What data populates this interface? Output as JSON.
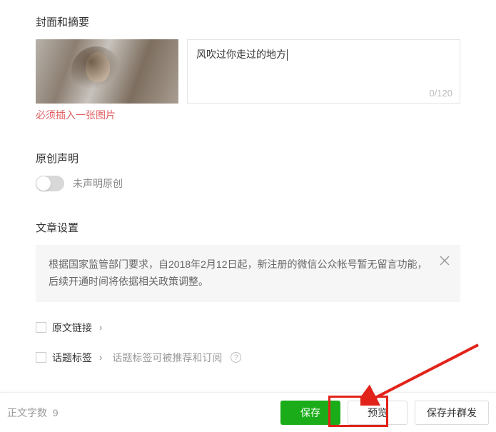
{
  "sections": {
    "cover_title": "封面和摘要",
    "original_title": "原创声明",
    "settings_title": "文章设置"
  },
  "cover": {
    "summary_value": "风吹过你走过的地方",
    "char_count": "0/120",
    "error": "必须插入一张图片"
  },
  "original": {
    "toggle_label": "未声明原创"
  },
  "notice": {
    "text": "根据国家监管部门要求，自2018年2月12日起，新注册的微信公众帐号暂无留言功能，后续开通时间将依据相关政策调整。"
  },
  "settings": {
    "source_link": "原文链接",
    "topic_tag": "话题标签",
    "topic_hint": "话题标签可被推荐和订阅"
  },
  "footer": {
    "word_count_label": "正文字数",
    "word_count_value": "9",
    "save": "保存",
    "preview": "预览",
    "save_and_send": "保存并群发"
  }
}
